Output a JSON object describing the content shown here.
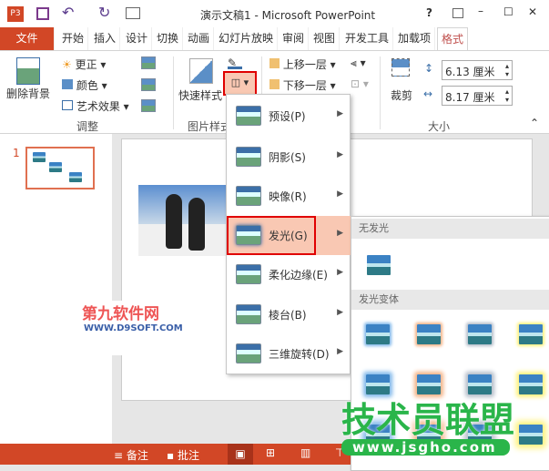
{
  "titlebar": {
    "title": "演示文稿1 - Microsoft PowerPoint",
    "app_icon": "P3",
    "help": "?",
    "minimize": "–",
    "maximize": "☐",
    "close": "✕",
    "undo": "↶",
    "redo": "↻"
  },
  "tabs": [
    {
      "label": "文件"
    },
    {
      "label": "开始"
    },
    {
      "label": "插入"
    },
    {
      "label": "设计"
    },
    {
      "label": "切换"
    },
    {
      "label": "动画"
    },
    {
      "label": "幻灯片放映"
    },
    {
      "label": "审阅"
    },
    {
      "label": "视图"
    },
    {
      "label": "开发工具"
    },
    {
      "label": "加载项"
    },
    {
      "label": "格式"
    }
  ],
  "ribbon": {
    "remove_bg": "删除背景",
    "corrections": "更正",
    "color": "颜色",
    "artistic": "艺术效果",
    "group_adjust": "调整",
    "quick_styles": "快速样式",
    "group_picture_styles": "图片样式",
    "bring_forward": "上移一层",
    "send_backward": "下移一层",
    "crop": "裁剪",
    "height": "6.13 厘米",
    "width": "8.17 厘米",
    "group_size": "大小"
  },
  "thumbs": {
    "slide_number": "1"
  },
  "effects_menu": [
    {
      "label": "预设(P)"
    },
    {
      "label": "阴影(S)"
    },
    {
      "label": "映像(R)"
    },
    {
      "label": "发光(G)"
    },
    {
      "label": "柔化边缘(E)"
    },
    {
      "label": "棱台(B)"
    },
    {
      "label": "三维旋转(D)"
    }
  ],
  "glow_submenu": {
    "no_glow_header": "无发光",
    "variations_header": "发光变体",
    "glow_colors": [
      "#7fb7ea",
      "#f4b183",
      "#b4bcc8",
      "#fff27a"
    ]
  },
  "status": {
    "notes": "备注",
    "comments": "批注"
  },
  "watermarks": {
    "left_logo": "第九软件网",
    "left_url": "WWW.D9SOFT.COM",
    "right_logo": "技术员联盟",
    "right_url": "www.jsgho.com"
  },
  "colors": {
    "accent": "#d24726",
    "hover": "#f9c8b3",
    "highlight_box": "#e00000"
  }
}
